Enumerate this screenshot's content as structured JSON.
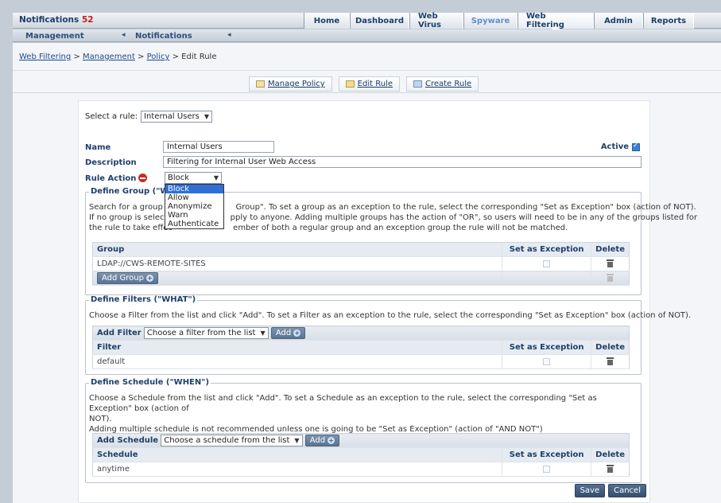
{
  "header": {
    "notifications_label": "Notifications",
    "notifications_count": "52",
    "tabs": [
      {
        "label": "Home"
      },
      {
        "label": "Dashboard"
      },
      {
        "label": "Web Virus"
      },
      {
        "label": "Spyware"
      },
      {
        "label": "Web Filtering"
      },
      {
        "label": "Admin"
      },
      {
        "label": "Reports"
      }
    ]
  },
  "subnav": {
    "management": "Management",
    "notifications": "Notifications",
    "arrow": "◂"
  },
  "breadcrumb": {
    "items": [
      "Web Filtering",
      "Management",
      "Policy"
    ],
    "separator": ">",
    "current": "Edit Rule"
  },
  "actions": {
    "manage_policy": "Manage Policy",
    "edit_rule": "Edit Rule",
    "create_rule": "Create Rule"
  },
  "form": {
    "select_rule_label": "Select a rule:",
    "select_rule_value": "Internal Users",
    "name_label": "Name",
    "name_value": "Internal Users",
    "active_label": "Active",
    "description_label": "Description",
    "description_value": "Filtering for Internal User Web Access",
    "rule_action_label": "Rule Action",
    "rule_action_value": "Block",
    "rule_action_options": [
      "Block",
      "Allow",
      "Anonymize",
      "Warn",
      "Authenticate"
    ]
  },
  "group_section": {
    "legend": "Define Group (\"WHO\")",
    "desc_line1": "Search for a group by                        Group\". To set a group as an exception to the rule, select the corresponding \"Set as Exception\" box (action of NOT).",
    "desc_line2": "If no group is selecte                       pply to anyone. Adding multiple groups has the action of \"OR\", so users will need to be in any of the groups listed for",
    "desc_line3": "the rule to take effec                        ember of both a regular group and an exception group the rule will not be matched.",
    "col_group": "Group",
    "col_exception": "Set as Exception",
    "col_delete": "Delete",
    "rows": [
      "LDAP://CWS-REMOTE-SITES"
    ],
    "add_button": "Add Group"
  },
  "filter_section": {
    "legend": "Define Filters (\"WHAT\")",
    "desc": "Choose a Filter from the list and click \"Add\". To set a Filter as an exception to the rule, select the corresponding \"Set as Exception\" box (action of NOT).",
    "add_label": "Add Filter",
    "select_value": "Choose a filter from the list",
    "add_button": "Add",
    "col_filter": "Filter",
    "col_exception": "Set as Exception",
    "col_delete": "Delete",
    "rows": [
      "default"
    ]
  },
  "schedule_section": {
    "legend": "Define Schedule (\"WHEN\")",
    "desc_line1": "Choose a Schedule from the list and click \"Add\". To set a Schedule as an exception to the rule, select the corresponding \"Set as Exception\" box (action of",
    "desc_line2": "NOT).",
    "desc_line3": "Adding multiple schedule is not recommended unless one is going to be \"Set as Exception\" (action of \"AND NOT\")",
    "add_label": "Add Schedule",
    "select_value": "Choose a schedule from the list",
    "add_button": "Add",
    "col_schedule": "Schedule",
    "col_exception": "Set as Exception",
    "col_delete": "Delete",
    "rows": [
      "anytime"
    ]
  },
  "footer": {
    "save": "Save",
    "cancel": "Cancel"
  }
}
